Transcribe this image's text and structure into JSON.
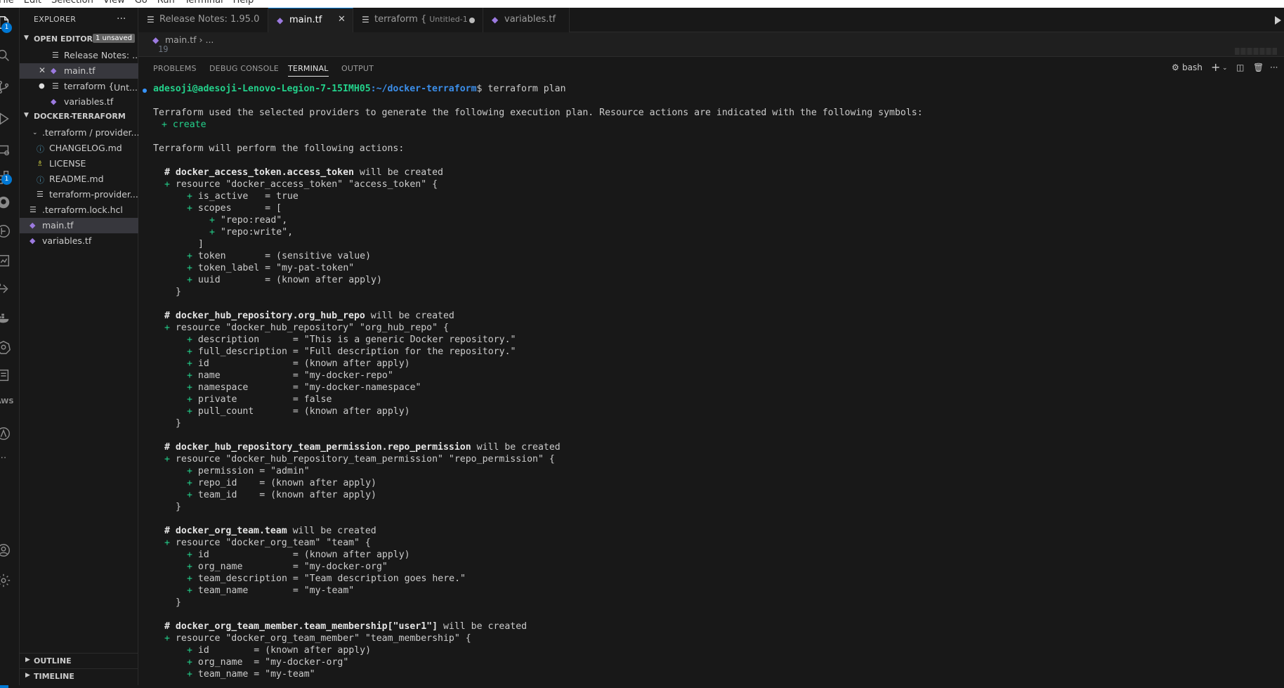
{
  "menubar": {
    "items": [
      "File",
      "Edit",
      "Selection",
      "View",
      "Go",
      "Run",
      "Terminal",
      "Help"
    ]
  },
  "activity_bar": {
    "explorer_badge": "1",
    "extensions_badge": "1",
    "aws_label": "AWS"
  },
  "sidebar": {
    "title": "EXPLORER",
    "more": "···",
    "open_editors": {
      "label": "OPEN EDITORS",
      "badge": "1 unsaved",
      "items": [
        {
          "label": "Release Notes: ...",
          "sub": ""
        },
        {
          "label": "main.tf",
          "sub": ""
        },
        {
          "label": "terraform {",
          "sub": "Unt..."
        },
        {
          "label": "variables.tf",
          "sub": ""
        }
      ]
    },
    "folder": {
      "label": "DOCKER-TERRAFORM",
      "items": [
        {
          "label": ".terraform / provider..."
        },
        {
          "label": "CHANGELOG.md"
        },
        {
          "label": "LICENSE"
        },
        {
          "label": "README.md"
        },
        {
          "label": "terraform-provider..."
        },
        {
          "label": ".terraform.lock.hcl"
        },
        {
          "label": "main.tf"
        },
        {
          "label": "variables.tf"
        }
      ]
    },
    "outline": "OUTLINE",
    "timeline": "TIMELINE"
  },
  "tabs": [
    {
      "label": "Release Notes: 1.95.0",
      "sub": ""
    },
    {
      "label": "main.tf",
      "sub": ""
    },
    {
      "label": "terraform {",
      "sub": "Untitled-1"
    },
    {
      "label": "variables.tf",
      "sub": ""
    }
  ],
  "breadcrumb": {
    "file": "main.tf",
    "rest": "› ...",
    "ghost_line": "19"
  },
  "panel": {
    "tabs": [
      "PROBLEMS",
      "DEBUG CONSOLE",
      "TERMINAL",
      "OUTPUT"
    ],
    "shell": "bash",
    "terminal": {
      "user": "adesoji@adesoji-Lenovo-Legion-7-15IMH05",
      "path": ":~/docker-terraform",
      "command": "$ terraform plan",
      "lines": [
        "Terraform used the selected providers to generate the following execution plan. Resource actions are indicated with the following symbols:",
        "+ create",
        "Terraform will perform the following actions:",
        "# docker_access_token.access_token",
        " will be created",
        "resource \"docker_access_token\" \"access_token\" {",
        "is_active   = true",
        "scopes      = [",
        "\"repo:read\",",
        "\"repo:write\",",
        "]",
        "token       = (sensitive value)",
        "token_label = \"my-pat-token\"",
        "uuid        = (known after apply)",
        "}",
        "# docker_hub_repository.org_hub_repo",
        " will be created",
        "resource \"docker_hub_repository\" \"org_hub_repo\" {",
        "description      = \"This is a generic Docker repository.\"",
        "full_description = \"Full description for the repository.\"",
        "id               = (known after apply)",
        "name             = \"my-docker-repo\"",
        "namespace        = \"my-docker-namespace\"",
        "private          = false",
        "pull_count       = (known after apply)",
        "}",
        "# docker_hub_repository_team_permission.repo_permission",
        " will be created",
        "resource \"docker_hub_repository_team_permission\" \"repo_permission\" {",
        "permission = \"admin\"",
        "repo_id    = (known after apply)",
        "team_id    = (known after apply)",
        "}",
        "# docker_org_team.team",
        " will be created",
        "resource \"docker_org_team\" \"team\" {",
        "id               = (known after apply)",
        "org_name         = \"my-docker-org\"",
        "team_description = \"Team description goes here.\"",
        "team_name        = \"my-team\"",
        "}",
        "# docker_org_team_member.team_membership[\"user1\"]",
        " will be created",
        "resource \"docker_org_team_member\" \"team_membership\" {",
        "id        = (known after apply)",
        "org_name  = \"my-docker-org\"",
        "team_name = \"my-team\""
      ]
    }
  }
}
